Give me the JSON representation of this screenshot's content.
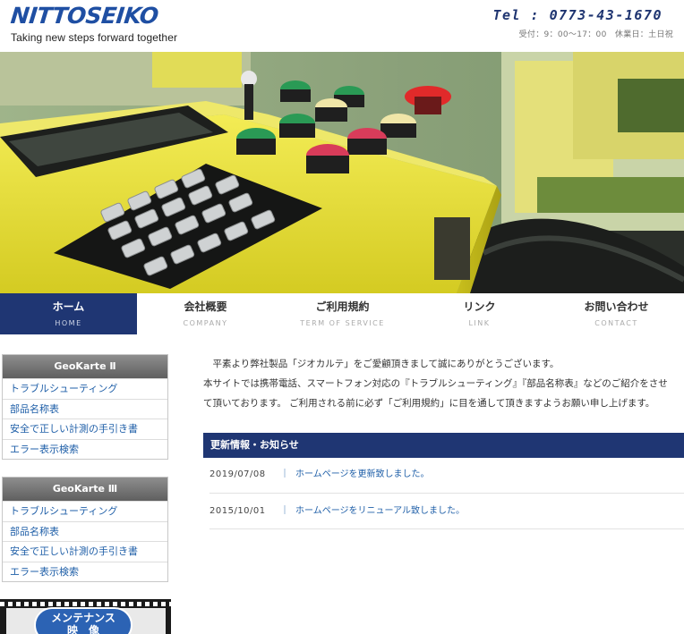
{
  "header": {
    "logo_text": "NITTOSEIKO",
    "tagline": "Taking new steps forward together",
    "tel": "Tel : 0773-43-1670",
    "hours": "受付：9：00〜17：00　休業日：土日祝"
  },
  "nav": [
    {
      "jp": "ホーム",
      "en": "HOME"
    },
    {
      "jp": "会社概要",
      "en": "COMPANY"
    },
    {
      "jp": "ご利用規約",
      "en": "TERM OF SERVICE"
    },
    {
      "jp": "リンク",
      "en": "LINK"
    },
    {
      "jp": "お問い合わせ",
      "en": "CONTACT"
    }
  ],
  "sidebar": {
    "boxes": [
      {
        "title": "GeoKarte Ⅱ",
        "links": [
          "トラブルシューティング",
          "部品名称表",
          "安全で正しい計測の手引き書",
          "エラー表示検索"
        ]
      },
      {
        "title": "GeoKarte Ⅲ",
        "links": [
          "トラブルシューティング",
          "部品名称表",
          "安全で正しい計測の手引き書",
          "エラー表示検索"
        ]
      }
    ],
    "maintenance_label_1": "メンテナンス",
    "maintenance_label_2": "映　像"
  },
  "main": {
    "intro": [
      "　平素より弊社製品「ジオカルテ」をご愛顧頂きまして誠にありがとうございます。",
      "本サイトでは携帯電話、スマートフォン対応の『トラブルシューティング』『部品名称表』などのご紹介をさせ",
      "て頂いております。 ご利用される前に必ず「ご利用規約」に目を通して頂きますようお願い申し上げます。"
    ],
    "news_title": "更新情報・お知らせ",
    "news": [
      {
        "date": "2019/07/08",
        "sep": "｜",
        "text": "ホームページを更新致しました。"
      },
      {
        "date": "2015/10/01",
        "sep": "｜",
        "text": "ホームページをリニューアル致しました。"
      }
    ]
  },
  "colors": {
    "brand_blue": "#1f4fa3",
    "nav_active": "#1f3673",
    "link_blue": "#1f5fa8",
    "device_yellow": "#e8e03a"
  }
}
